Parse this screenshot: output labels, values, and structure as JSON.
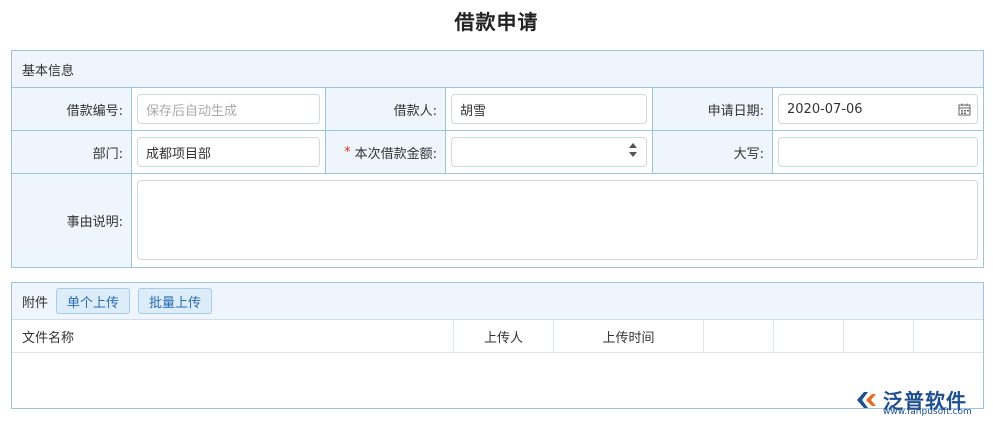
{
  "page": {
    "title": "借款申请"
  },
  "basic": {
    "section_title": "基本信息",
    "loan_no": {
      "label": "借款编号:",
      "placeholder": "保存后自动生成"
    },
    "borrower": {
      "label": "借款人:",
      "value": "胡雪"
    },
    "apply_date": {
      "label": "申请日期:",
      "value": "2020-07-06"
    },
    "department": {
      "label": "部门:",
      "value": "成都项目部"
    },
    "amount": {
      "label": "本次借款金额:",
      "required_mark": "*",
      "value": ""
    },
    "uppercase": {
      "label": "大写:",
      "value": ""
    },
    "reason": {
      "label": "事由说明:",
      "value": ""
    }
  },
  "attachments": {
    "label": "附件",
    "single_upload": "单个上传",
    "batch_upload": "批量上传",
    "columns": [
      "文件名称",
      "上传人",
      "上传时间",
      "",
      "",
      ""
    ],
    "rows": []
  },
  "watermark": {
    "brand": "泛普软件",
    "url": "www.fanpusoft.com"
  },
  "colors": {
    "border": "#9cc5dc",
    "header_bg": "#eef5fc",
    "button_text": "#2a6bb0",
    "required": "#e0302a"
  }
}
